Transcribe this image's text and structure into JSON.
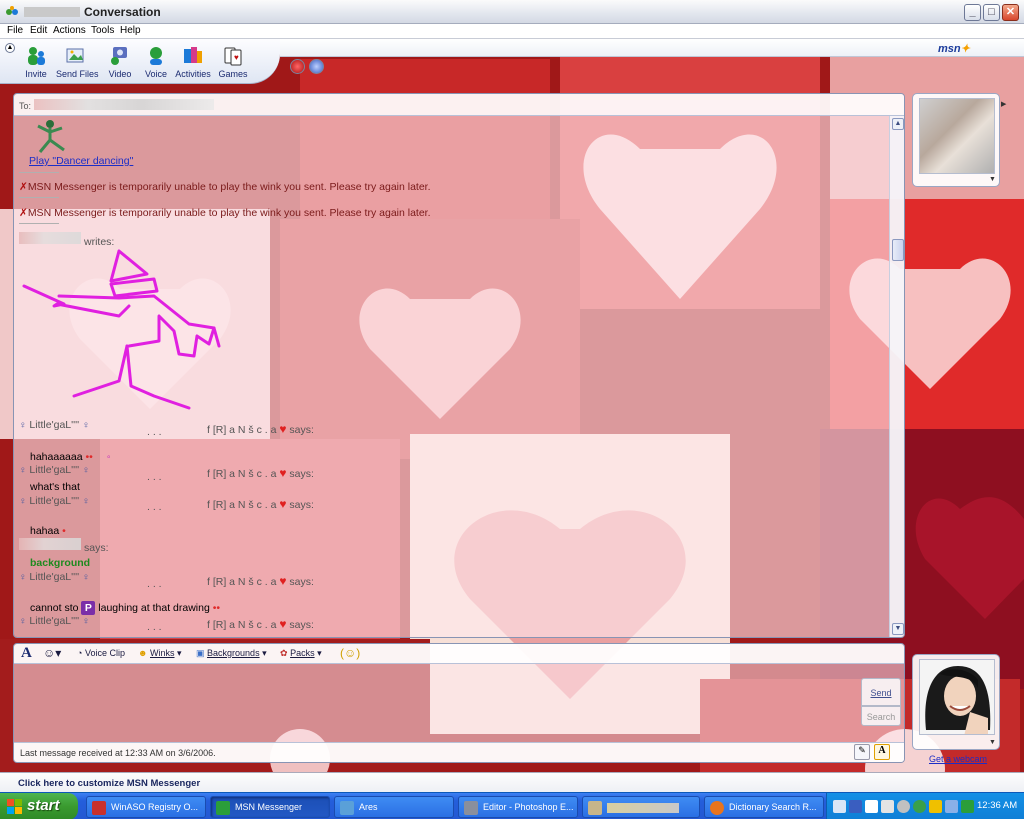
{
  "window": {
    "title": "Conversation",
    "controls": {
      "minimize": "_",
      "maximize": "□",
      "close": "✕"
    }
  },
  "menu": [
    "File",
    "Edit",
    "Actions",
    "Tools",
    "Help"
  ],
  "toolbar": {
    "items": [
      {
        "label": "Invite",
        "icon": "invite-icon"
      },
      {
        "label": "Send Files",
        "icon": "send-files-icon"
      },
      {
        "label": "Video",
        "icon": "video-icon"
      },
      {
        "label": "Voice",
        "icon": "voice-icon"
      },
      {
        "label": "Activities",
        "icon": "activities-icon"
      },
      {
        "label": "Games",
        "icon": "games-icon"
      }
    ],
    "logo": "msn"
  },
  "conversation": {
    "to_label": "To:",
    "wink_link": "Play \"Dancer dancing\"",
    "error_1": "MSN Messenger is temporarily unable to play the wink you sent. Please try again later.",
    "error_2": "MSN Messenger is temporarily unable to play the wink you sent. Please try again later.",
    "writes": "writes:",
    "nick_a": "Little'gaL''''",
    "nick_b_dots": ". . .",
    "nick_b": "f [R] a N š c . a",
    "says": "says:",
    "messages": [
      {
        "text": "hahaaaaaa"
      },
      {
        "text": "what's that"
      },
      {
        "text": "hahaa"
      },
      {
        "text": "background"
      },
      {
        "text": "cannot sto"
      },
      {
        "text": "laughing at that drawing"
      }
    ]
  },
  "compose": {
    "voice_clip": "Voice Clip",
    "winks": "Winks",
    "backgrounds": "Backgrounds",
    "packs": "Packs",
    "send": "Send",
    "search": "Search",
    "status": "Last message received at 12:33 AM on 3/6/2006."
  },
  "side": {
    "webcam_link": "Get a webcam"
  },
  "customize": "Click here to customize MSN Messenger",
  "taskbar": {
    "start": "start",
    "tasks": [
      {
        "label": "WinASO Registry O...",
        "color": "#c8302c"
      },
      {
        "label": "MSN Messenger",
        "color": "#2b9e3a",
        "active": true
      },
      {
        "label": "Ares",
        "color": "#5aa0d8"
      },
      {
        "label": "Editor - Photoshop E...",
        "color": "#8a8f9c"
      },
      {
        "label": "",
        "color": "#c7b58a"
      },
      {
        "label": "Dictionary Search R...",
        "color": "#e8741e"
      }
    ],
    "clock": "12:36 AM"
  }
}
